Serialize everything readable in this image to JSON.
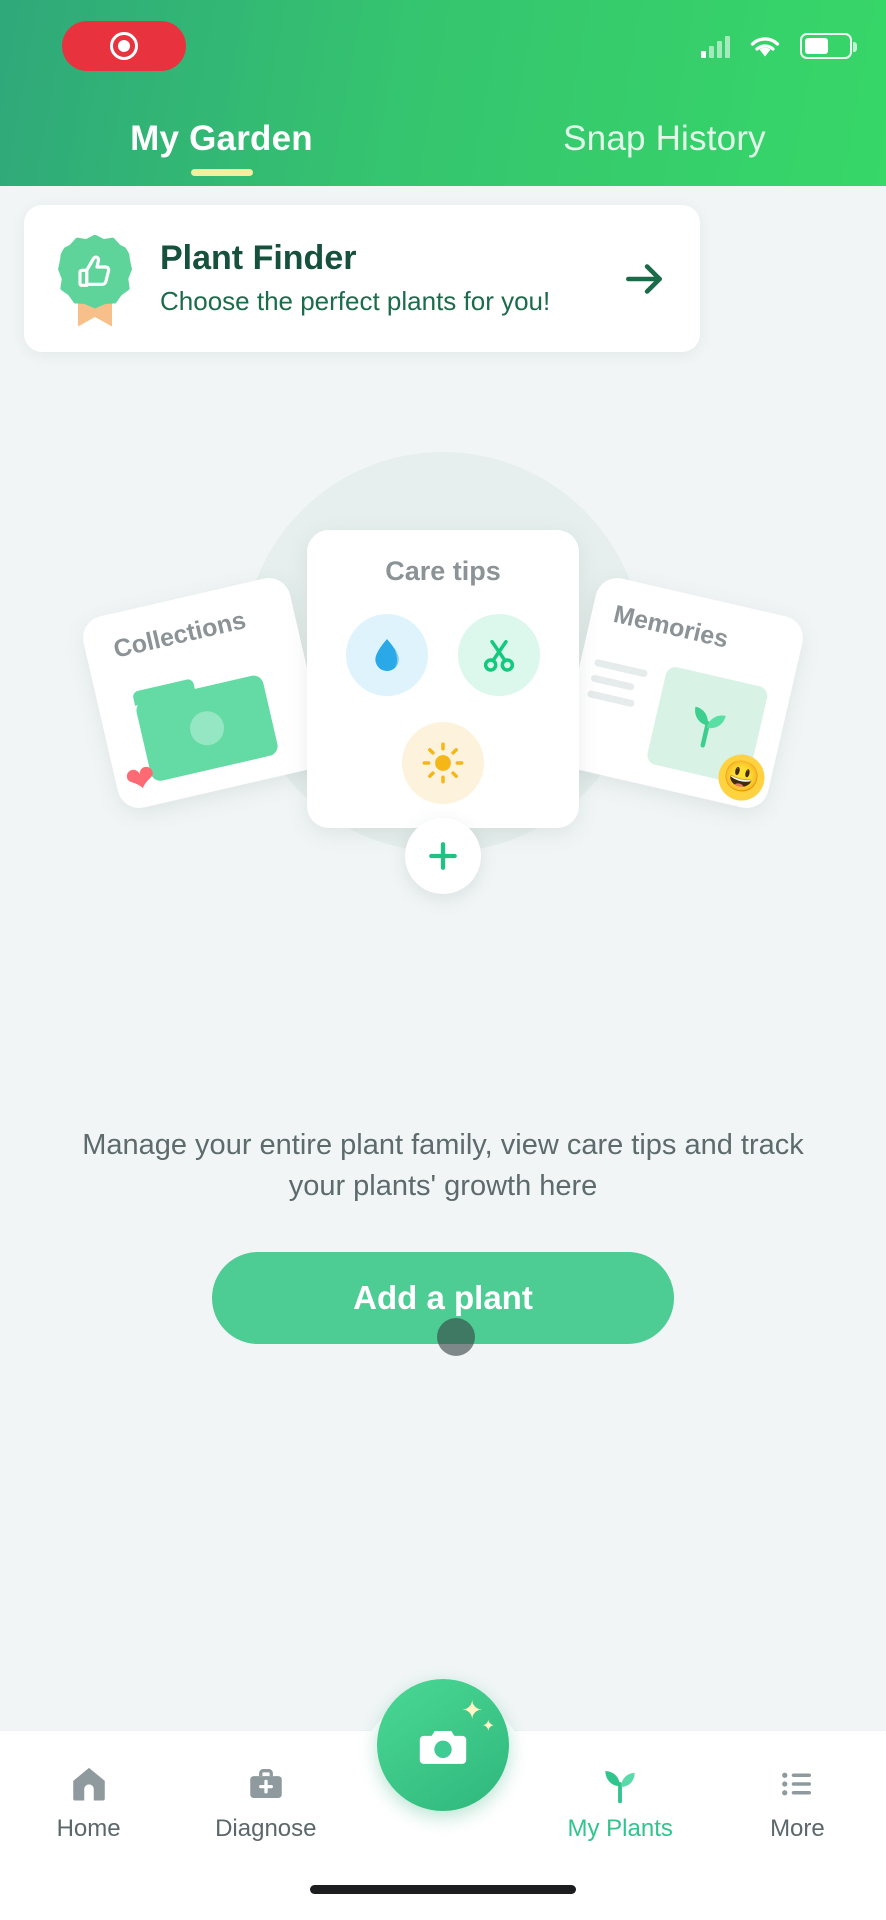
{
  "status_bar": {
    "recording_indicator": "record-pill",
    "signal_icon": "cellular-signal-icon",
    "wifi_icon": "wifi-icon",
    "battery_icon": "battery-icon"
  },
  "header": {
    "tabs": [
      {
        "label": "My Garden",
        "active": true
      },
      {
        "label": "Snap History",
        "active": false
      }
    ]
  },
  "finder_card": {
    "title": "Plant Finder",
    "subtitle": "Choose the perfect plants for you!",
    "badge_icon": "thumbs-up-badge-icon",
    "arrow_icon": "arrow-right-icon"
  },
  "illustration": {
    "collections_label": "Collections",
    "care_label": "Care tips",
    "memories_label": "Memories",
    "care_icons": [
      "water-drop-icon",
      "scissors-icon",
      "sun-icon"
    ],
    "memories_emoji": "😃",
    "plus_icon": "plus-icon"
  },
  "empty_state": {
    "description": "Manage your entire plant family, view care tips and track your plants' growth here",
    "cta_label": "Add a plant"
  },
  "bottom_nav": {
    "items": [
      {
        "label": "Home",
        "icon": "home-icon",
        "active": false
      },
      {
        "label": "Diagnose",
        "icon": "briefcase-icon",
        "active": false
      },
      {
        "label": "My Plants",
        "icon": "leaf-icon",
        "active": true
      },
      {
        "label": "More",
        "icon": "list-icon",
        "active": false
      }
    ],
    "camera_button": "camera-icon"
  },
  "colors": {
    "header_gradient_start": "#2fa87a",
    "header_gradient_end": "#37d768",
    "accent_green": "#4dcc94",
    "active_nav": "#31c48d",
    "tab_underline": "#f5eea0",
    "page_background": "#f1f5f6",
    "record_red": "#e8333f"
  }
}
